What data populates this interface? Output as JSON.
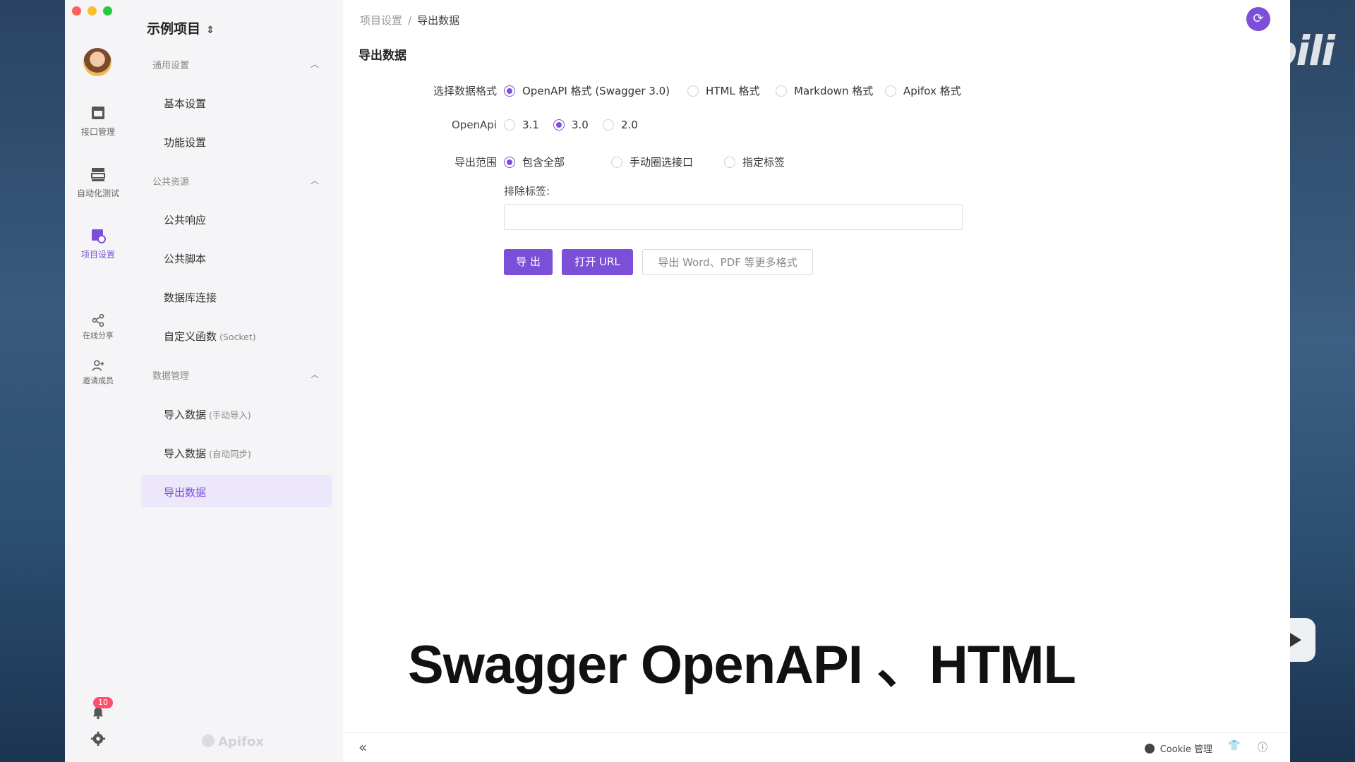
{
  "watermark": "bilibili",
  "app": {
    "project_name": "示例项目",
    "project_caret": "⌃⌄",
    "brand": "Apifox"
  },
  "rail": {
    "items": [
      {
        "label": "接口管理",
        "icon": "api-management-icon"
      },
      {
        "label": "自动化测试",
        "icon": "automation-test-icon"
      },
      {
        "label": "项目设置",
        "icon": "project-settings-icon"
      },
      {
        "label": "在线分享",
        "icon": "share-icon"
      },
      {
        "label": "邀请成员",
        "icon": "invite-member-icon"
      }
    ],
    "notification_count": "10"
  },
  "menu": {
    "groups": [
      {
        "label": "通用设置",
        "items": [
          {
            "label": "基本设置",
            "sub": ""
          },
          {
            "label": "功能设置",
            "sub": ""
          }
        ]
      },
      {
        "label": "公共资源",
        "items": [
          {
            "label": "公共响应",
            "sub": ""
          },
          {
            "label": "公共脚本",
            "sub": ""
          },
          {
            "label": "数据库连接",
            "sub": ""
          },
          {
            "label": "自定义函数",
            "sub": "(Socket)"
          }
        ]
      },
      {
        "label": "数据管理",
        "items": [
          {
            "label": "导入数据",
            "sub": "(手动导入)"
          },
          {
            "label": "导入数据",
            "sub": "(自动同步)"
          },
          {
            "label": "导出数据",
            "sub": ""
          }
        ]
      }
    ]
  },
  "breadcrumb": {
    "parent": "项目设置",
    "separator": "/",
    "current": "导出数据"
  },
  "page_title": "导出数据",
  "form": {
    "format": {
      "label": "选择数据格式",
      "options": [
        "OpenAPI 格式 (Swagger 3.0)",
        "HTML 格式",
        "Markdown 格式",
        "Apifox 格式"
      ],
      "selected": "OpenAPI 格式 (Swagger 3.0)"
    },
    "openapi": {
      "label": "OpenApi",
      "options": [
        "3.1",
        "3.0",
        "2.0"
      ],
      "selected": "3.0"
    },
    "scope": {
      "label": "导出范围",
      "options": [
        "包含全部",
        "手动圈选接口",
        "指定标签"
      ],
      "selected": "包含全部"
    },
    "exclude_label": "排除标签:",
    "exclude_value": ""
  },
  "buttons": {
    "export": "导 出",
    "open_url": "打开 URL",
    "more_formats": "导出 Word、PDF 等更多格式"
  },
  "caption": "Swagger OpenAPI 、HTML",
  "footer": {
    "collapse": "«",
    "cookie": "Cookie 管理"
  },
  "colors": {
    "accent": "#7b4fd8",
    "badge": "#ff4d6a"
  }
}
